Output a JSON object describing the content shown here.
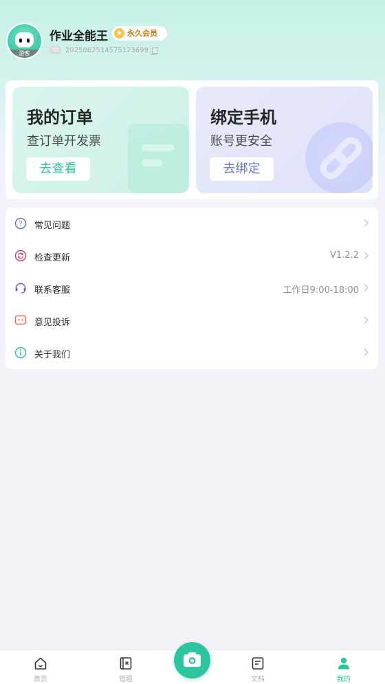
{
  "profile": {
    "username": "作业全能王",
    "vip_label": "永久会员",
    "id_tag": "ID",
    "user_id": "2025062514575123699",
    "avatar_badge": "游客"
  },
  "cards": {
    "orders": {
      "title": "我的订单",
      "subtitle": "查订单开发票",
      "button": "去查看"
    },
    "phone": {
      "title": "绑定手机",
      "subtitle": "账号更安全",
      "button": "去绑定"
    }
  },
  "menu": {
    "items": [
      {
        "label": "常见问题",
        "value": "",
        "icon": "question-icon"
      },
      {
        "label": "检查更新",
        "value": "V1.2.2",
        "icon": "refresh-icon"
      },
      {
        "label": "联系客服",
        "value": "工作日9:00-18:00",
        "icon": "headset-icon"
      },
      {
        "label": "意见投诉",
        "value": "",
        "icon": "feedback-icon"
      },
      {
        "label": "关于我们",
        "value": "",
        "icon": "info-icon"
      }
    ]
  },
  "tabbar": {
    "items": [
      {
        "label": "首页",
        "icon": "home-icon"
      },
      {
        "label": "错题",
        "icon": "mistake-book-icon"
      },
      {
        "label": "文档",
        "icon": "document-icon"
      },
      {
        "label": "我的",
        "icon": "person-icon",
        "active": true
      }
    ],
    "camera_icon": "camera-icon"
  },
  "colors": {
    "accent": "#2fc4a0",
    "vip_gold": "#c07d12",
    "phone_accent": "#6b78d6"
  }
}
